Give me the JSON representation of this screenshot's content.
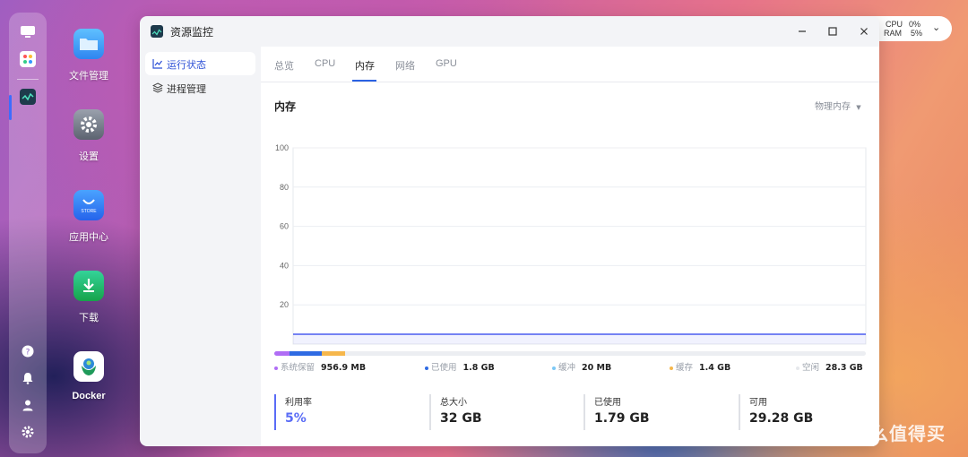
{
  "desktop": {
    "items": [
      {
        "label": "文件管理",
        "icon": "folder-icon",
        "color": "#2f95f5"
      },
      {
        "label": "设置",
        "icon": "gear-icon",
        "color": "#6b7280"
      },
      {
        "label": "应用中心",
        "icon": "store-icon",
        "color": "#2f7af5",
        "sub": "STORE"
      },
      {
        "label": "下载",
        "icon": "download-icon",
        "color": "#22c55e"
      },
      {
        "label": "Docker",
        "icon": "docker-icon",
        "color": "#ffffff"
      }
    ]
  },
  "sysmon": {
    "cpu_label": "CPU",
    "cpu_value": "0%",
    "ram_label": "RAM",
    "ram_value": "5%"
  },
  "window": {
    "title": "资源监控",
    "sidebar": [
      {
        "label": "运行状态",
        "icon": "chart-line-icon",
        "active": true
      },
      {
        "label": "进程管理",
        "icon": "layers-icon",
        "active": false
      }
    ],
    "tabs": [
      {
        "label": "总览"
      },
      {
        "label": "CPU"
      },
      {
        "label": "内存",
        "active": true
      },
      {
        "label": "网络"
      },
      {
        "label": "GPU"
      }
    ],
    "card_title": "内存",
    "dropdown_label": "物理内存"
  },
  "chart_data": {
    "type": "line",
    "y_ticks": [
      "100",
      "80",
      "60",
      "40",
      "20"
    ],
    "ylim": [
      0,
      100
    ],
    "series": [
      {
        "color": "#4a5df0",
        "values": [
          5,
          5,
          5,
          5,
          5,
          5,
          5,
          5,
          5,
          5,
          5,
          5
        ]
      }
    ],
    "grid": true
  },
  "memory": {
    "usage_bar": [
      {
        "fraction": 0.025,
        "color": "#b06df5"
      },
      {
        "fraction": 0.055,
        "color": "#2f6be3"
      },
      {
        "fraction": 0.04,
        "color": "#f6b74c"
      }
    ],
    "legend": [
      {
        "label": "系统保留",
        "value": "956.9 MB",
        "color": "#b06df5"
      },
      {
        "label": "已使用",
        "value": "1.8 GB",
        "color": "#2f6be3"
      },
      {
        "label": "缓冲",
        "value": "20 MB",
        "color": "#7cc8f5"
      },
      {
        "label": "缓存",
        "value": "1.4 GB",
        "color": "#f6b74c"
      },
      {
        "label": "空闲",
        "value": "28.3 GB",
        "color": "#e6e8ec"
      }
    ],
    "stats": [
      {
        "label": "利用率",
        "value": "5%"
      },
      {
        "label": "总大小",
        "value": "32 GB"
      },
      {
        "label": "已使用",
        "value": "1.79 GB"
      },
      {
        "label": "可用",
        "value": "29.28 GB"
      }
    ]
  },
  "watermark": {
    "text": "什么值得买",
    "badge": "值"
  }
}
